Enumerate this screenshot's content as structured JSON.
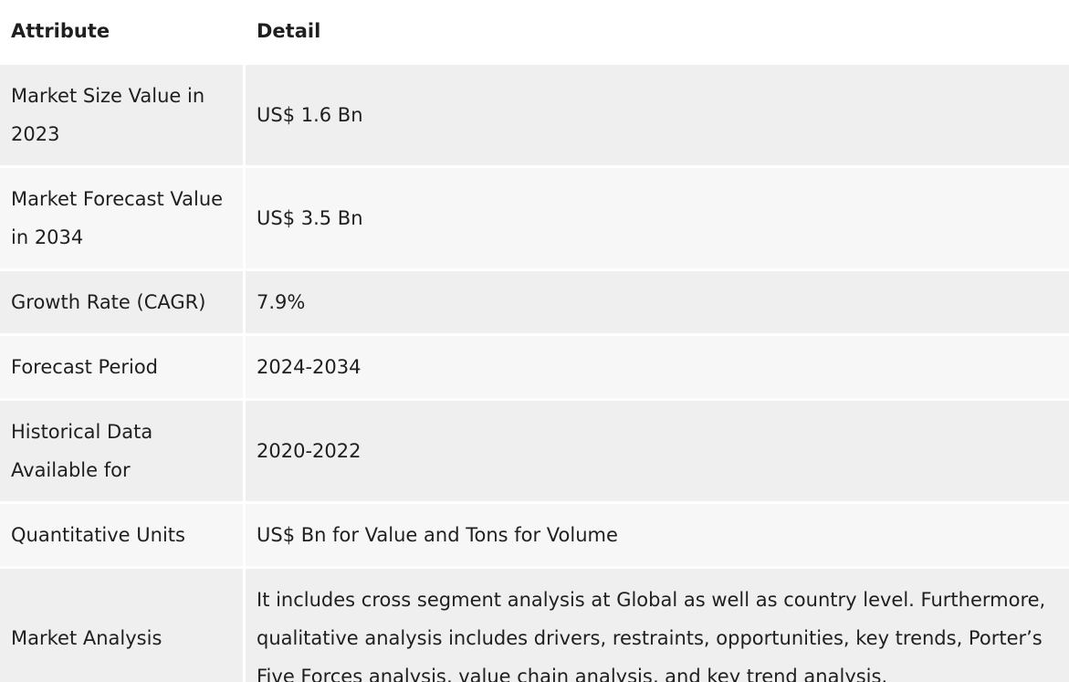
{
  "table": {
    "headers": {
      "attribute": "Attribute",
      "detail": "Detail"
    },
    "rows": [
      {
        "attribute": "Market Size Value in 2023",
        "detail": "US$ 1.6 Bn"
      },
      {
        "attribute": "Market Forecast Value in 2034",
        "detail": "US$ 3.5 Bn"
      },
      {
        "attribute": "Growth Rate (CAGR)",
        "detail": "7.9%"
      },
      {
        "attribute": "Forecast Period",
        "detail": "2024-2034"
      },
      {
        "attribute": "Historical Data Available for",
        "detail": "2020-2022"
      },
      {
        "attribute": "Quantitative Units",
        "detail": "US$ Bn for Value and Tons for Volume"
      },
      {
        "attribute": "Market Analysis",
        "detail": "It includes cross segment analysis at Global as well as country level. Furthermore, qualitative analysis includes drivers, restraints, opportunities, key trends, Porter’s Five Forces analysis, value chain analysis, and key trend analysis."
      }
    ]
  },
  "colors": {
    "row_dark": "#efefef",
    "row_light": "#f7f7f7",
    "text": "#1f1f1f"
  }
}
